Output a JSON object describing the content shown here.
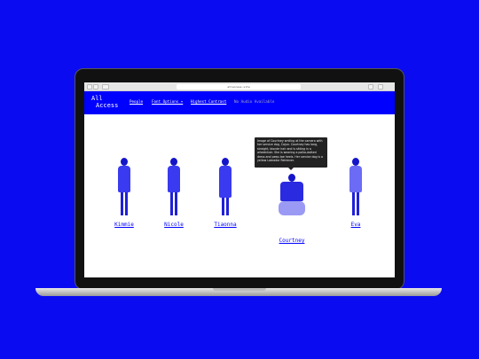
{
  "browser": {
    "url": "allaccess.site"
  },
  "site": {
    "logo_line1": "All",
    "logo_line2": "Access",
    "nav": [
      {
        "label": "People"
      },
      {
        "label": "Font Options ▾"
      },
      {
        "label": "Highest Contrast"
      },
      {
        "label": "No Audio Available"
      }
    ]
  },
  "people": [
    {
      "name": "Kimmie"
    },
    {
      "name": "Nicole"
    },
    {
      "name": "Tiaonna"
    },
    {
      "name": "Courtney"
    },
    {
      "name": "Eva"
    }
  ],
  "tooltip": "Image of Courtney smiling at the camera with her service dog, Cajun. Courtney has long, straight, blonde hair and is sitting in a wheelchair. She is wearing a polka-dotted dress and peep-toe heels. Her service dog is a yellow Labrador Retriever.",
  "colors": {
    "background": "#0b0bf2",
    "accent": "#0000ff"
  }
}
